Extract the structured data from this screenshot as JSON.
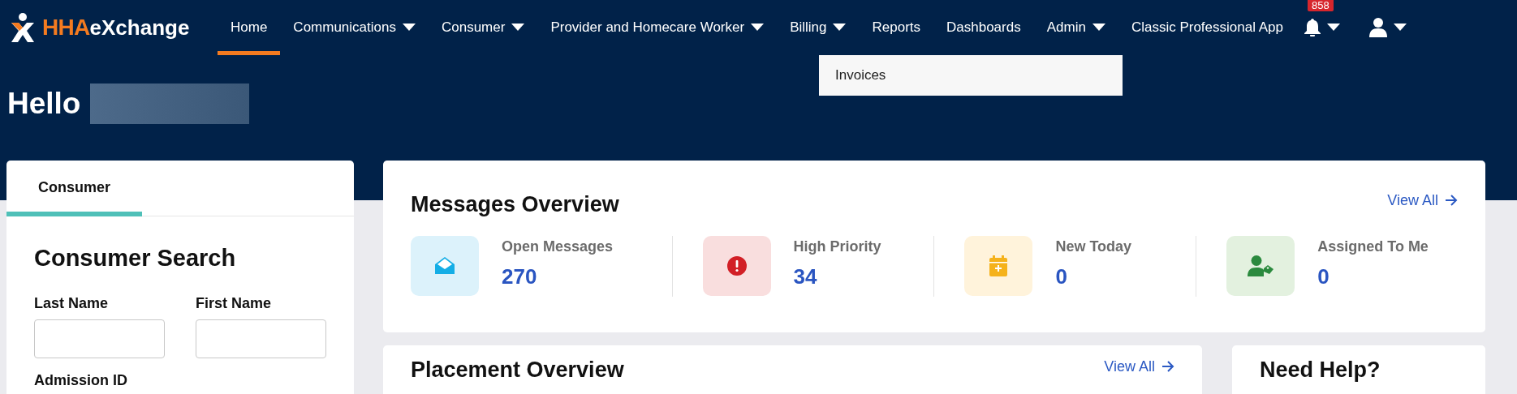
{
  "logo": {
    "part_1": "HHA",
    "part_2": "eXchange"
  },
  "nav": [
    {
      "label": "Home",
      "selected": true,
      "dropdown": false
    },
    {
      "label": "Communications",
      "selected": false,
      "dropdown": true
    },
    {
      "label": "Consumer",
      "selected": false,
      "dropdown": true
    },
    {
      "label": "Provider and Homecare Worker",
      "selected": false,
      "dropdown": true
    },
    {
      "label": "Billing",
      "selected": false,
      "dropdown": true
    },
    {
      "label": "Reports",
      "selected": false,
      "dropdown": false
    },
    {
      "label": "Dashboards",
      "selected": false,
      "dropdown": false
    },
    {
      "label": "Admin",
      "selected": false,
      "dropdown": true
    },
    {
      "label": "Classic Professional App",
      "selected": false,
      "dropdown": false
    }
  ],
  "notifications": {
    "badge": "858"
  },
  "open_menu": {
    "items": [
      "Invoices"
    ]
  },
  "greeting": "Hello",
  "consumer_panel": {
    "tabs": [
      {
        "label": "Consumer",
        "selected": true
      }
    ],
    "title": "Consumer Search",
    "fields": [
      {
        "label": "Last Name"
      },
      {
        "label": "First Name"
      }
    ],
    "field_3_label": "Admission ID"
  },
  "messages": {
    "title": "Messages Overview",
    "link": "View All",
    "stats": [
      {
        "kind": "open",
        "label": "Open Messages",
        "value": "270"
      },
      {
        "kind": "priority",
        "label": "High Priority",
        "value": "34"
      },
      {
        "kind": "new",
        "label": "New Today",
        "value": "0"
      },
      {
        "kind": "assigned",
        "label": "Assigned To Me",
        "value": "0"
      }
    ]
  },
  "placement": {
    "title": "Placement Overview",
    "link": "View All"
  },
  "help": {
    "title": "Need Help?"
  }
}
